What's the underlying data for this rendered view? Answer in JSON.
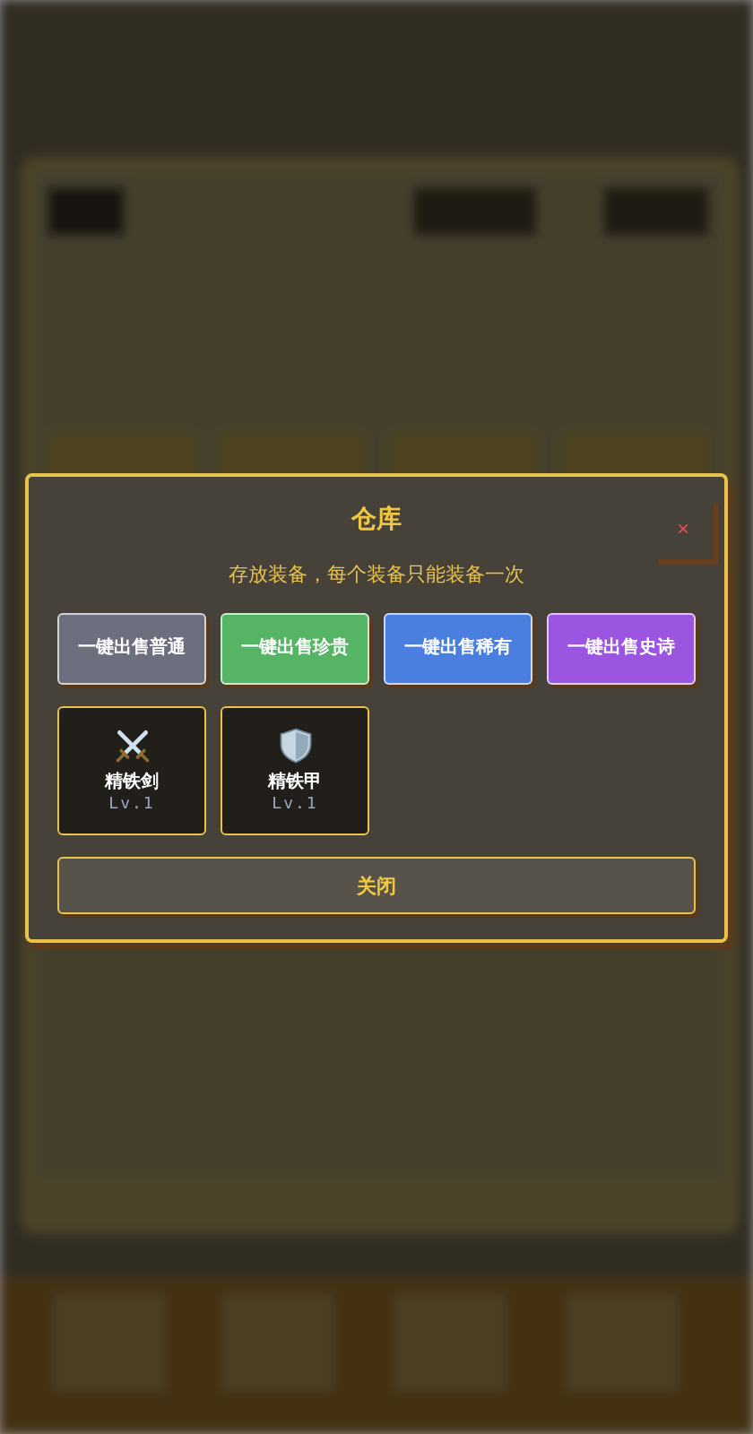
{
  "dialog": {
    "title": "仓库",
    "close": "×",
    "subtitle": "存放装备，每个装备只能装备一次",
    "sell_buttons": [
      {
        "label": "一键出售普通",
        "color": "#6b6f7e"
      },
      {
        "label": "一键出售珍贵",
        "color": "#55b565"
      },
      {
        "label": "一键出售稀有",
        "color": "#4a7fe0"
      },
      {
        "label": "一键出售史诗",
        "color": "#9b55e0"
      }
    ],
    "items": [
      {
        "kind": "sword",
        "name": "精铁剑",
        "level": "Lv.1"
      },
      {
        "kind": "shield",
        "name": "精铁甲",
        "level": "Lv.1"
      }
    ],
    "close_button": "关闭"
  }
}
